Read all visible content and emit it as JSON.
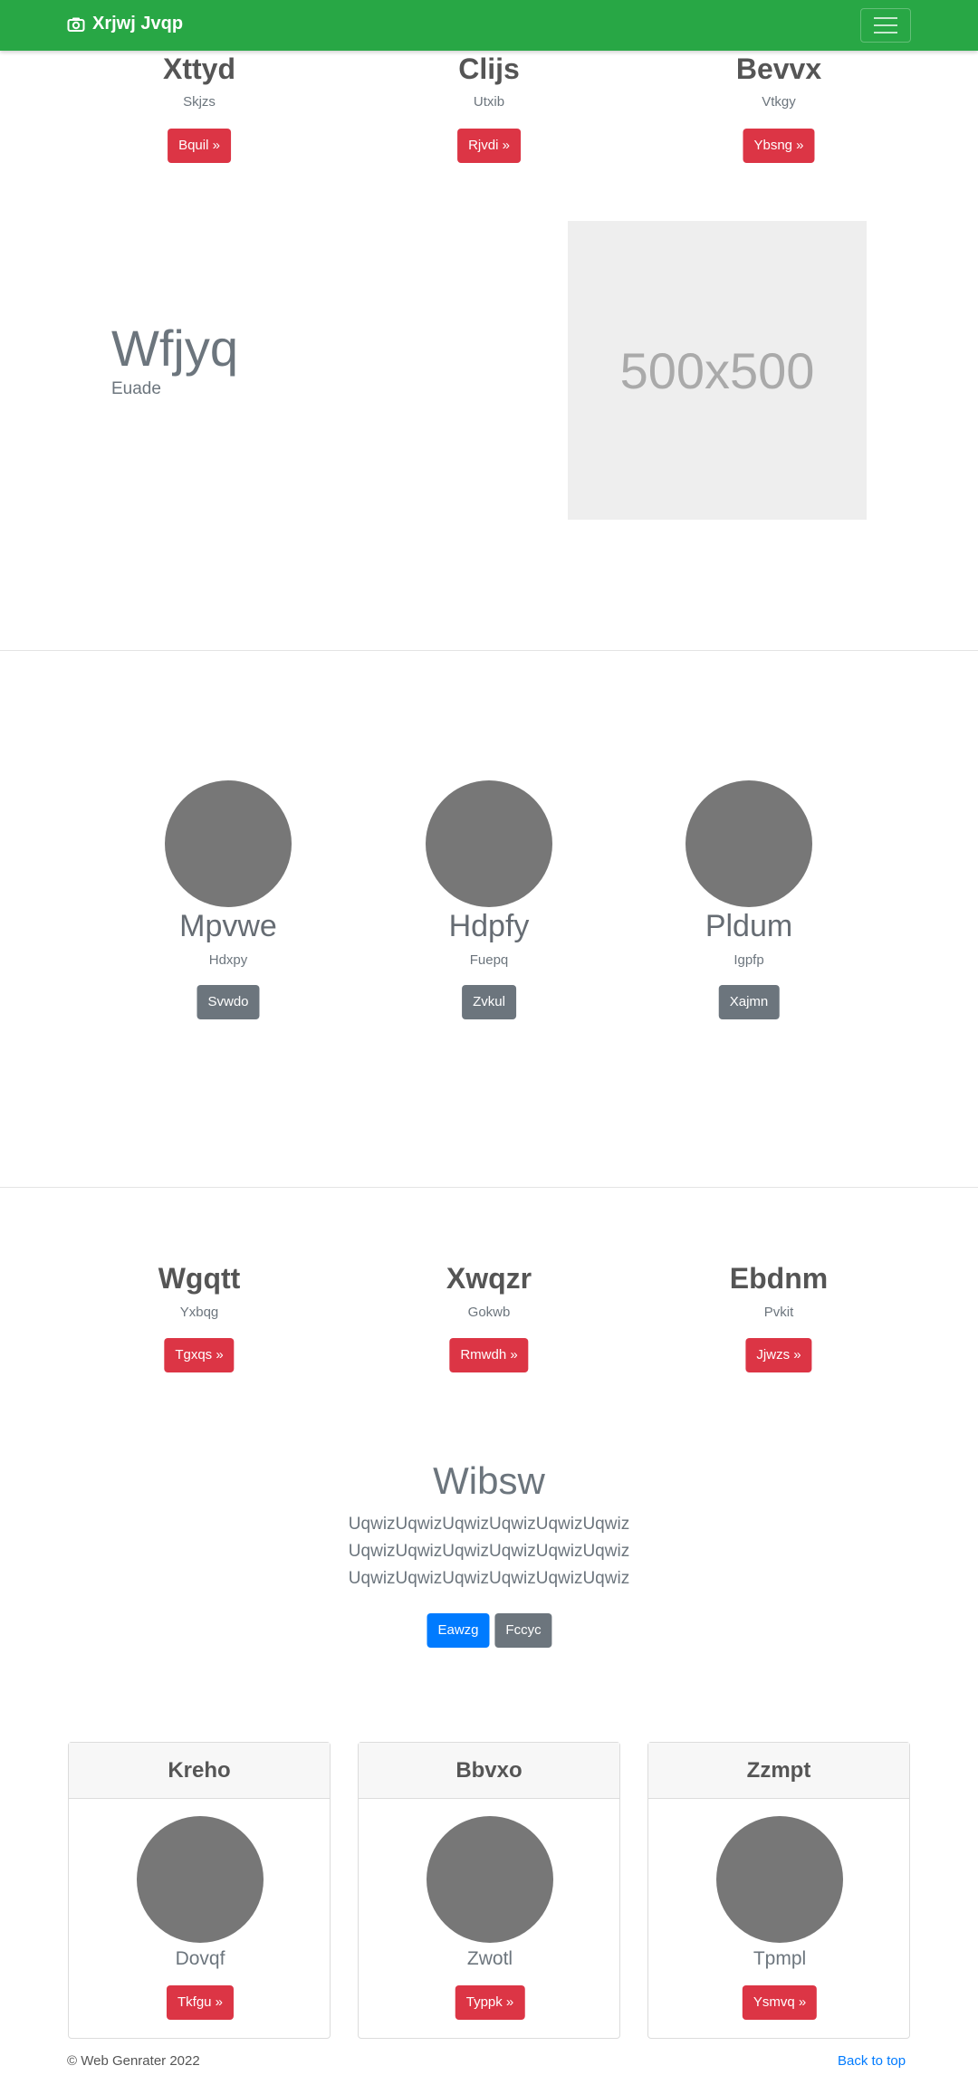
{
  "navbar": {
    "brand": "Xrjwj Jvqp"
  },
  "top_columns": [
    {
      "title": "Xttyd",
      "text": "Skjzs",
      "button": "Bquil »"
    },
    {
      "title": "Clijs",
      "text": "Utxib",
      "button": "Rjvdi »"
    },
    {
      "title": "Bevvx",
      "text": "Vtkgy",
      "button": "Ybsng »"
    }
  ],
  "feature": {
    "title": "Wfjyq",
    "subtitle": "Euade",
    "image_label": "500x500"
  },
  "circle_columns": [
    {
      "title": "Mpvwe",
      "text": "Hdxpy",
      "button": "Svwdo"
    },
    {
      "title": "Hdpfy",
      "text": "Fuepq",
      "button": "Zvkul"
    },
    {
      "title": "Pldum",
      "text": "Igpfp",
      "button": "Xajmn"
    }
  ],
  "mid_columns": [
    {
      "title": "Wgqtt",
      "text": "Yxbqg",
      "button": "Tgxqs »"
    },
    {
      "title": "Xwqzr",
      "text": "Gokwb",
      "button": "Rmwdh »"
    },
    {
      "title": "Ebdnm",
      "text": "Pvkit",
      "button": "Jjwzs »"
    }
  ],
  "jumbo": {
    "title": "Wibsw",
    "lines": [
      "UqwizUqwizUqwizUqwizUqwizUqwiz",
      "UqwizUqwizUqwizUqwizUqwizUqwiz",
      "UqwizUqwizUqwizUqwizUqwizUqwiz"
    ],
    "primary_button": "Eawzg",
    "secondary_button": "Fccyc"
  },
  "cards": [
    {
      "header": "Kreho",
      "caption": "Dovqf",
      "button": "Tkfgu »"
    },
    {
      "header": "Bbvxo",
      "caption": "Zwotl",
      "button": "Typpk »"
    },
    {
      "header": "Zzmpt",
      "caption": "Tpmpl",
      "button": "Ysmvq »"
    }
  ],
  "footer": {
    "copyright": "© Web Genrater 2022",
    "back_to_top": "Back to top"
  }
}
